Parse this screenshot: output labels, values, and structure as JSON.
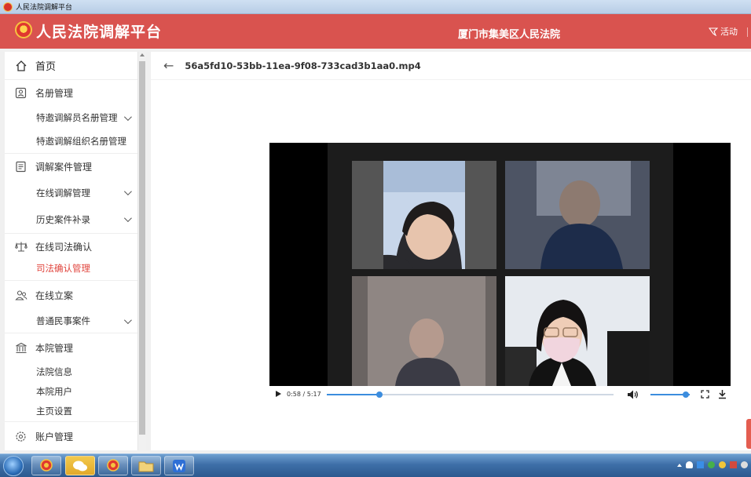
{
  "window": {
    "title": "人民法院调解平台"
  },
  "header": {
    "app_title": "人民法院调解平台",
    "court_name": "厦门市集美区人民法院",
    "activity_label": "活动"
  },
  "sidebar": {
    "home": "首页",
    "groups": [
      {
        "title": "名册管理",
        "icon": "roster-icon",
        "items": [
          {
            "label": "特邀调解员名册管理",
            "expandable": true
          },
          {
            "label": "特邀调解组织名册管理",
            "expandable": false
          }
        ]
      },
      {
        "title": "调解案件管理",
        "icon": "document-icon",
        "items": [
          {
            "label": "在线调解管理",
            "expandable": true
          },
          {
            "label": "历史案件补录",
            "expandable": true
          }
        ]
      },
      {
        "title": "在线司法确认",
        "icon": "scales-icon",
        "items": [
          {
            "label": "司法确认管理",
            "expandable": false,
            "active": true
          }
        ]
      },
      {
        "title": "在线立案",
        "icon": "users-icon",
        "items": [
          {
            "label": "普通民事案件",
            "expandable": true
          }
        ]
      },
      {
        "title": "本院管理",
        "icon": "court-building-icon",
        "items": [
          {
            "label": "法院信息",
            "expandable": false
          },
          {
            "label": "本院用户",
            "expandable": false
          },
          {
            "label": "主页设置",
            "expandable": false
          }
        ]
      },
      {
        "title": "账户管理",
        "icon": "gear-icon",
        "items": []
      }
    ]
  },
  "main": {
    "file_name": "56a5fd10-53bb-11ea-9f08-733cad3b1aa0.mp4"
  },
  "player": {
    "time": "0:58 / 5:17",
    "progress": 0.183,
    "volume": 0.9
  },
  "taskbar": {
    "apps": [
      "court-app-icon",
      "wechat-icon",
      "mediation-app-icon",
      "folder-icon",
      "wps-icon"
    ]
  },
  "colors": {
    "brand": "#d9534f",
    "accent": "#3c8dde",
    "active_menu": "#e0443c"
  }
}
